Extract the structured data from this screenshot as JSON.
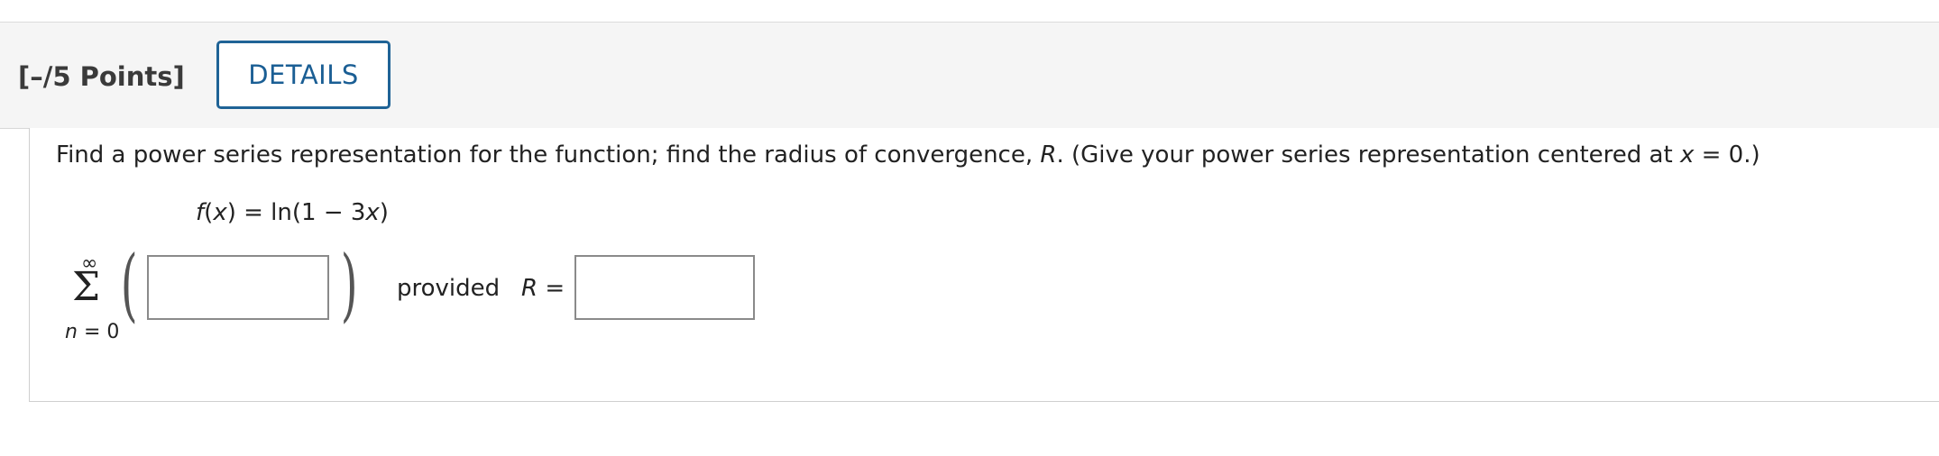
{
  "header": {
    "points_label": "[–/5 Points]",
    "details_button_label": "DETAILS"
  },
  "question": {
    "text_part1": "Find a power series representation for the function; find the radius of convergence, ",
    "var_R": "R",
    "text_part2": ". (Give your power series representation centered at ",
    "var_x": "x",
    "text_part3": " = 0.)"
  },
  "function": {
    "f": "f",
    "open": "(",
    "x": "x",
    "rest": ") = ln(1 − 3",
    "x2": "x",
    "close": ")"
  },
  "summation": {
    "upper": "∞",
    "symbol": "Σ",
    "lower_var": "n",
    "lower_rest": " = 0",
    "left_paren": "(",
    "right_paren": ")",
    "series_input_value": ""
  },
  "radius": {
    "provided_label": "provided",
    "R_symbol": "R",
    "equals": " =",
    "input_value": ""
  }
}
